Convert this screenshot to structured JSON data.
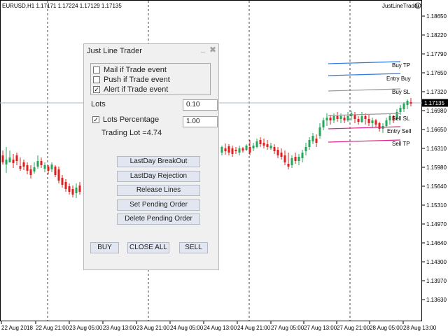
{
  "chart": {
    "symbol_label": "EURUSD,H1  1.17171 1.17224 1.17129 1.17135",
    "indicator_name": "JustLineTrader",
    "price_ticks": [
      "1.18650",
      "1.18220",
      "1.17790",
      "1.17650",
      "1.17320",
      "1.16980",
      "1.16650",
      "1.16310",
      "1.15980",
      "1.15640",
      "1.15310",
      "1.14970",
      "1.14640",
      "1.14300",
      "1.13970",
      "1.13630"
    ],
    "current_price": "1.17135",
    "time_ticks": [
      "22 Aug 2018",
      "22 Aug 21:00",
      "23 Aug 05:00",
      "23 Aug 13:00",
      "23 Aug 21:00",
      "24 Aug 05:00",
      "24 Aug 13:00",
      "24 Aug 21:00",
      "27 Aug 05:00",
      "27 Aug 13:00",
      "27 Aug 21:00",
      "28 Aug 05:00",
      "28 Aug 13:00"
    ],
    "colors": {
      "bull": "#26a65b",
      "bear": "#e0201e",
      "grid": "#444444",
      "price_line": "#a7b7c8",
      "buy_line": "#2b78e4",
      "sell_line": "#e0208c",
      "sl_line": "#999999"
    },
    "lines": [
      {
        "label": "Buy TP"
      },
      {
        "label": "Entry Buy"
      },
      {
        "label": "Buy SL"
      },
      {
        "label": "Sell SL"
      },
      {
        "label": "Entry Sell"
      },
      {
        "label": "Sell TP"
      }
    ]
  },
  "panel": {
    "title": "Just Line Trader",
    "minimize_icon": "minimize-icon",
    "close_icon": "close-icon",
    "checkboxes": [
      {
        "label": "Mail if Trade event",
        "checked": false
      },
      {
        "label": "Push if Trade event",
        "checked": false
      },
      {
        "label": "Alert if Trade event",
        "checked": true
      }
    ],
    "lots_label": "Lots",
    "lots_value": "0.10",
    "lots_pct_label": "Lots Percentage",
    "lots_pct_checked": true,
    "lots_pct_value": "1.00",
    "trading_lot": "Trading Lot =4.74",
    "buttons": {
      "lastday_breakout": "LastDay BreakOut",
      "lastday_rejection": "LastDay Rejection",
      "release_lines": "Release Lines",
      "set_pending": "Set Pending Order",
      "delete_pending": "Delete Pending Order",
      "buy": "BUY",
      "close_all": "CLOSE ALL",
      "sell": "SELL"
    }
  }
}
